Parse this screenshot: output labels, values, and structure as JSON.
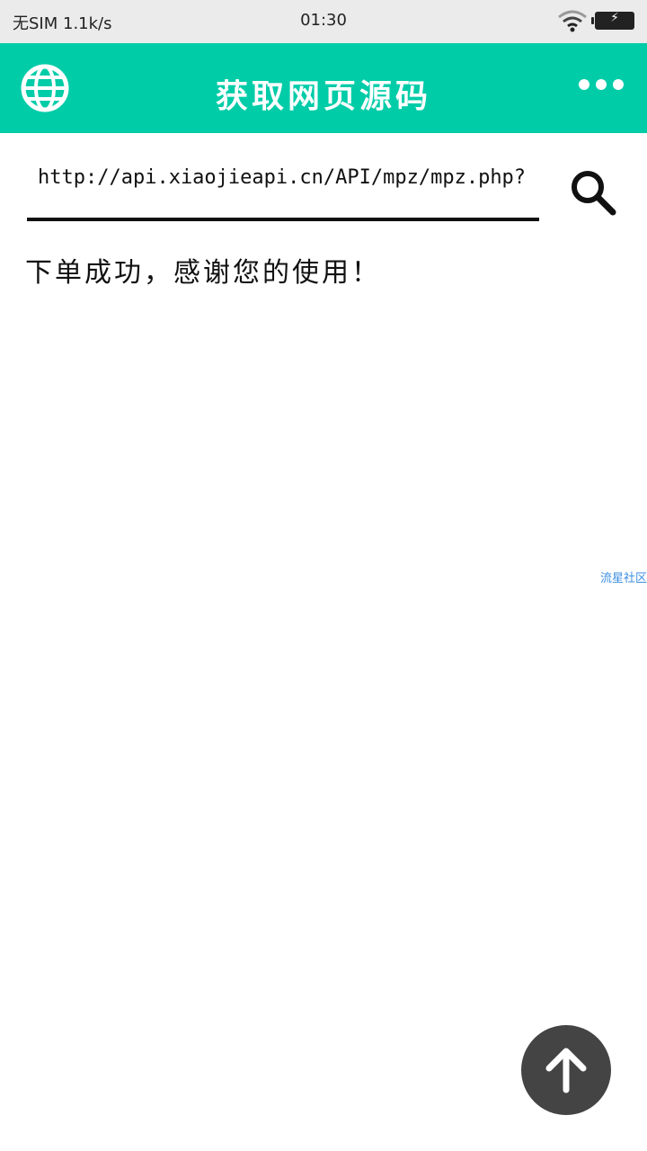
{
  "status_bar": {
    "carrier": "无SIM 1.1k/s",
    "time": "01:30",
    "battery_icon": "battery-charging-icon",
    "wifi_icon": "wifi-icon"
  },
  "app_bar": {
    "title": "获取网页源码",
    "left_icon": "globe-icon",
    "right_icon": "more-dots-icon",
    "background": "#00cca8"
  },
  "url_bar": {
    "value": "http://api.xiaojieapi.cn/API/mpz/mpz.php?",
    "search_icon": "search-icon"
  },
  "result": {
    "text": "下单成功，感谢您的使用！"
  },
  "watermark": {
    "text": "流星社区"
  },
  "fab": {
    "icon": "arrow-up-icon",
    "color": "#444444"
  }
}
